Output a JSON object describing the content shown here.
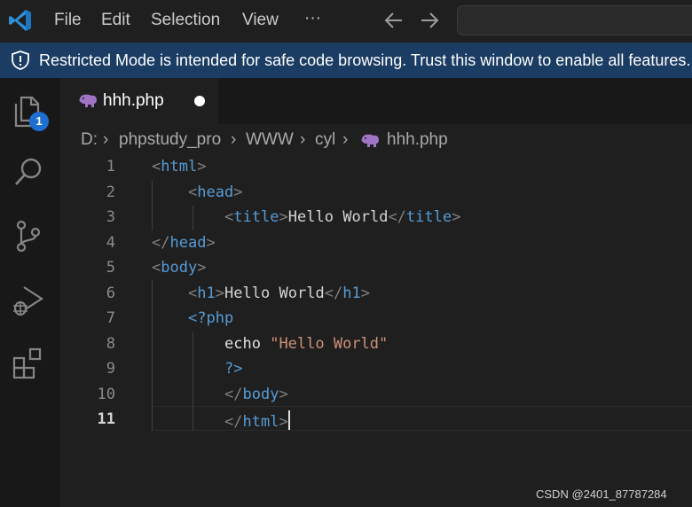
{
  "menu": {
    "file": "File",
    "edit": "Edit",
    "selection": "Selection",
    "view": "View",
    "more": "···"
  },
  "banner": {
    "text": "Restricted Mode is intended for safe code browsing. Trust this window to enable all features."
  },
  "activity_bar": {
    "explorer_badge": "1",
    "items": [
      "explorer-icon",
      "search-icon",
      "source-control-icon",
      "run-debug-icon",
      "extensions-icon"
    ]
  },
  "tab": {
    "label": "hhh.php",
    "dirty": true
  },
  "breadcrumb": [
    "D:",
    "phpstudy_pro",
    "WWW",
    "cyl",
    "hhh.php"
  ],
  "editor": {
    "active_line": 11,
    "line_numbers": [
      "1",
      "2",
      "3",
      "4",
      "5",
      "6",
      "7",
      "8",
      "9",
      "10",
      "11"
    ],
    "lines": [
      "<html>",
      "    <head>",
      "        <title>Hello World</title>",
      "</head>",
      "<body>",
      "    <h1>Hello World</h1>",
      "    <?php",
      "        echo \"Hello World\"",
      "        ?>",
      "        </body>",
      "        </html>"
    ]
  },
  "colors": {
    "banner_bg": "#1b3c63",
    "tag": "#569cd6",
    "string": "#ce9178",
    "badge": "#1f6fd1"
  },
  "watermark": "CSDN @2401_87787284"
}
